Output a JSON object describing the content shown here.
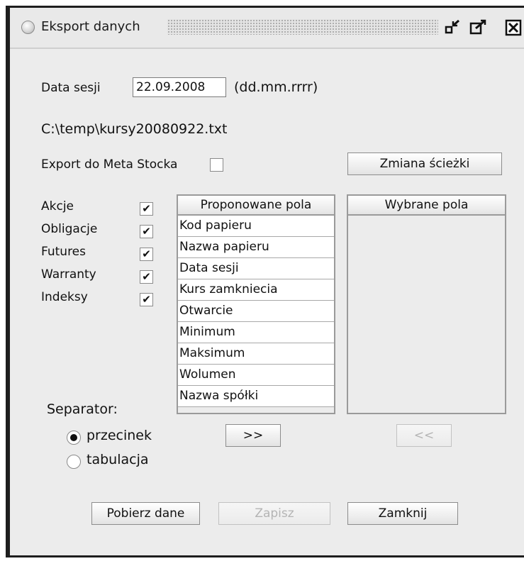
{
  "window": {
    "title": "Eksport danych"
  },
  "session": {
    "date_label": "Data sesji",
    "date_value": "22.09.2008",
    "date_format": "(dd.mm.rrrr)"
  },
  "path": {
    "file_path": "C:\\temp\\kursy20080922.txt"
  },
  "metastock": {
    "label": "Export do Meta Stocka",
    "checked": false
  },
  "buttons": {
    "change_path": "Zmiana ścieżki",
    "add": ">>",
    "remove": "<<",
    "fetch": "Pobierz dane",
    "save": "Zapisz",
    "close": "Zamknij"
  },
  "instruments": [
    {
      "label": "Akcje",
      "checked": true,
      "mark": "✔"
    },
    {
      "label": "Obligacje",
      "checked": true,
      "mark": "✔"
    },
    {
      "label": "Futures",
      "checked": true,
      "mark": "✔"
    },
    {
      "label": "Warranty",
      "checked": true,
      "mark": "✔"
    },
    {
      "label": "Indeksy",
      "checked": true,
      "mark": "✔"
    }
  ],
  "proposed": {
    "header": "Proponowane pola",
    "items": [
      "Kod papieru",
      "Nazwa papieru",
      "Data sesji",
      "Kurs zamkniecia",
      "Otwarcie",
      "Minimum",
      "Maksimum",
      "Wolumen",
      "Nazwa spółki"
    ]
  },
  "selected": {
    "header": "Wybrane pola",
    "items": []
  },
  "separator": {
    "label": "Separator:",
    "options": [
      {
        "label": "przecinek",
        "selected": true
      },
      {
        "label": "tabulacja",
        "selected": false
      }
    ]
  },
  "colors": {
    "window_bg": "#ececec",
    "frame": "#1e1e1e",
    "disabled_text": "#b4b4b4"
  },
  "icons": {
    "window": "circle-icon",
    "minimize": "minimize-icon",
    "maximize": "maximize-icon",
    "close": "close-icon"
  }
}
